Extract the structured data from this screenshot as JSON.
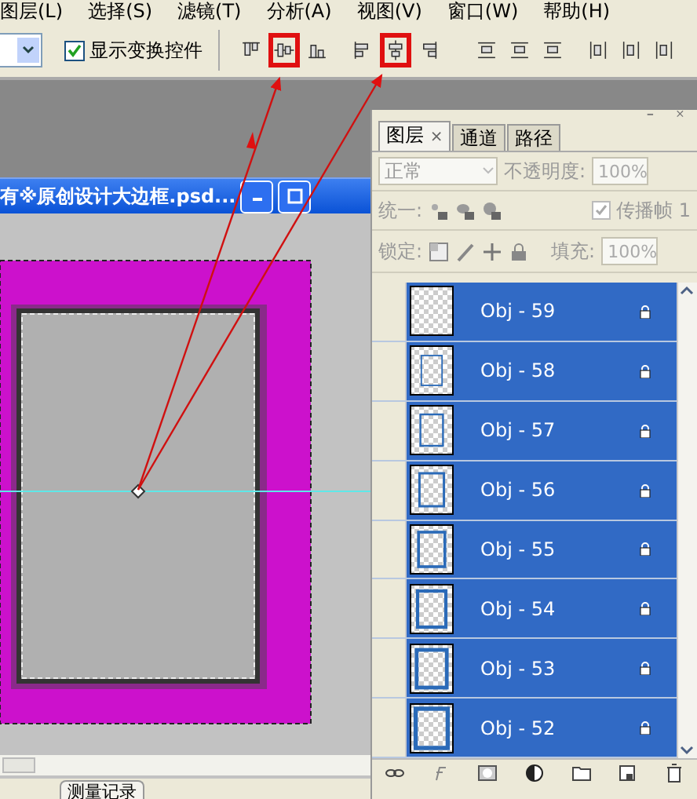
{
  "menu_bar": {
    "items": [
      "图层(L)",
      "选择(S)",
      "滤镜(T)",
      "分析(A)",
      "视图(V)",
      "窗口(W)",
      "帮助(H)"
    ]
  },
  "options_bar": {
    "show_transform_controls": {
      "label": "显示变换控件",
      "checked": true
    },
    "align_buttons": [
      {
        "kind": "top",
        "selected": false
      },
      {
        "kind": "vcenter",
        "selected": true
      },
      {
        "kind": "bottom",
        "selected": false
      },
      {
        "kind": "left",
        "selected": false
      },
      {
        "kind": "hcenter",
        "selected": true
      },
      {
        "kind": "right",
        "selected": false
      },
      {
        "kind": "dist-top",
        "selected": false
      },
      {
        "kind": "dist-vcenter",
        "selected": false
      },
      {
        "kind": "dist-bottom",
        "selected": false
      },
      {
        "kind": "dist-left",
        "selected": false
      },
      {
        "kind": "dist-hcenter",
        "selected": false
      },
      {
        "kind": "dist-right",
        "selected": false
      }
    ]
  },
  "document": {
    "title": "有※原创设计大边框.psd..."
  },
  "layers_panel": {
    "tabs": [
      {
        "label": "图层",
        "selected": true
      },
      {
        "label": "通道",
        "selected": false
      },
      {
        "label": "路径",
        "selected": false
      }
    ],
    "tab_close": "×",
    "blend_mode": "正常",
    "opacity_label": "不透明度:",
    "opacity": "100%",
    "unify_label": "统一:",
    "propagate": {
      "label": "传播帧 1",
      "checked": true
    },
    "lock_label": "锁定:",
    "fill_label": "填充:",
    "fill": "100%",
    "layers": [
      {
        "name": "Obj - 59",
        "selected": true,
        "visible": false
      },
      {
        "name": "Obj - 58",
        "selected": true,
        "visible": false
      },
      {
        "name": "Obj - 57",
        "selected": true,
        "visible": false
      },
      {
        "name": "Obj - 56",
        "selected": true,
        "visible": false
      },
      {
        "name": "Obj - 55",
        "selected": true,
        "visible": false
      },
      {
        "name": "Obj - 54",
        "selected": true,
        "visible": false
      },
      {
        "name": "Obj - 53",
        "selected": true,
        "visible": false
      },
      {
        "name": "Obj - 52",
        "selected": true,
        "visible": false
      }
    ]
  },
  "status_tabs": [
    "测量记录"
  ]
}
